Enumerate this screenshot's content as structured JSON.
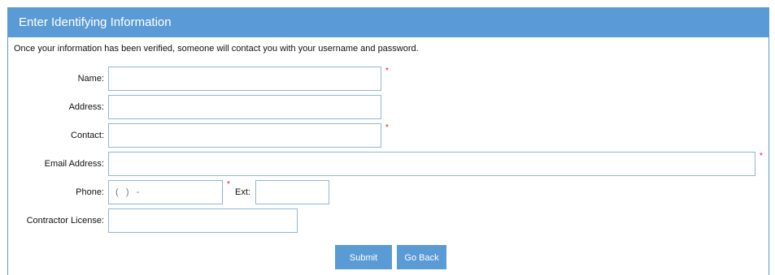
{
  "panel": {
    "title": "Enter Identifying Information",
    "intro": "Once your information has been verified, someone will contact you with your username and password."
  },
  "form": {
    "name_label": "Name:",
    "address_label": "Address:",
    "contact_label": "Contact:",
    "email_label": "Email Address:",
    "phone_label": "Phone:",
    "phone_placeholder": "(   )   -",
    "ext_label": "Ext:",
    "license_label": "Contractor License:",
    "required_marker": "*",
    "name_value": "",
    "address_value": "",
    "contact_value": "",
    "email_value": "",
    "phone_value": "",
    "ext_value": "",
    "license_value": ""
  },
  "buttons": {
    "submit_label": "Submit",
    "go_back_label": "Go Back"
  },
  "colors": {
    "accent": "#5b9bd5",
    "field_border": "#8fb6dd",
    "required": "#e21b1b"
  }
}
